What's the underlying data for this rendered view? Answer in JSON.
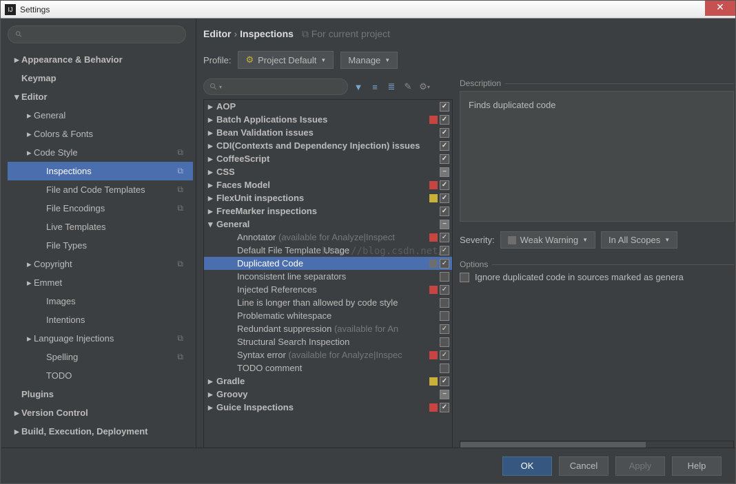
{
  "window": {
    "title": "Settings"
  },
  "breadcrumb": {
    "a": "Editor",
    "b": "Inspections",
    "suffix": "For current project"
  },
  "profile": {
    "label": "Profile:",
    "value": "Project Default",
    "manage": "Manage"
  },
  "sidebar": {
    "items": [
      {
        "label": "Appearance & Behavior",
        "arrow": "▸",
        "bold": true,
        "depth": 0
      },
      {
        "label": "Keymap",
        "bold": true,
        "depth": 0
      },
      {
        "label": "Editor",
        "arrow": "▾",
        "bold": true,
        "depth": 0
      },
      {
        "label": "General",
        "arrow": "▸",
        "depth": 1
      },
      {
        "label": "Colors & Fonts",
        "arrow": "▸",
        "depth": 1
      },
      {
        "label": "Code Style",
        "arrow": "▸",
        "depth": 1,
        "badge": "⧉"
      },
      {
        "label": "Inspections",
        "depth": 2,
        "selected": true,
        "badge": "⧉"
      },
      {
        "label": "File and Code Templates",
        "depth": 2,
        "badge": "⧉"
      },
      {
        "label": "File Encodings",
        "depth": 2,
        "badge": "⧉"
      },
      {
        "label": "Live Templates",
        "depth": 2
      },
      {
        "label": "File Types",
        "depth": 2
      },
      {
        "label": "Copyright",
        "arrow": "▸",
        "depth": 1,
        "badge": "⧉"
      },
      {
        "label": "Emmet",
        "arrow": "▸",
        "depth": 1
      },
      {
        "label": "Images",
        "depth": 2
      },
      {
        "label": "Intentions",
        "depth": 2
      },
      {
        "label": "Language Injections",
        "arrow": "▸",
        "depth": 1,
        "badge": "⧉"
      },
      {
        "label": "Spelling",
        "depth": 2,
        "badge": "⧉"
      },
      {
        "label": "TODO",
        "depth": 2
      },
      {
        "label": "Plugins",
        "bold": true,
        "depth": 0
      },
      {
        "label": "Version Control",
        "arrow": "▸",
        "bold": true,
        "depth": 0
      },
      {
        "label": "Build, Execution, Deployment",
        "arrow": "▸",
        "bold": true,
        "depth": 0
      }
    ]
  },
  "inspections": [
    {
      "label": "AOP",
      "arrow": "▸",
      "bold": true,
      "chk": "on"
    },
    {
      "label": "Batch Applications Issues",
      "arrow": "▸",
      "bold": true,
      "sev": "red",
      "chk": "on"
    },
    {
      "label": "Bean Validation issues",
      "arrow": "▸",
      "bold": true,
      "chk": "on"
    },
    {
      "label": "CDI(Contexts and Dependency Injection) issues",
      "arrow": "▸",
      "bold": true,
      "chk": "on"
    },
    {
      "label": "CoffeeScript",
      "arrow": "▸",
      "bold": true,
      "chk": "on"
    },
    {
      "label": "CSS",
      "arrow": "▸",
      "bold": true,
      "chk": "mixed"
    },
    {
      "label": "Faces Model",
      "arrow": "▸",
      "bold": true,
      "sev": "red",
      "chk": "on"
    },
    {
      "label": "FlexUnit inspections",
      "arrow": "▸",
      "bold": true,
      "sev": "yellow",
      "chk": "on"
    },
    {
      "label": "FreeMarker inspections",
      "arrow": "▸",
      "bold": true,
      "chk": "on"
    },
    {
      "label": "General",
      "arrow": "▾",
      "bold": true,
      "chk": "mixed"
    },
    {
      "label": "Annotator",
      "muted": " (available for Analyze|Inspect",
      "child": true,
      "sev": "red",
      "chk": "on"
    },
    {
      "label": "Default File Template Usage",
      "child": true,
      "chk": "on"
    },
    {
      "label": "Duplicated Code",
      "child": true,
      "selected": true,
      "sev": "gray",
      "chk": "on"
    },
    {
      "label": "Inconsistent line separators",
      "child": true,
      "chk": ""
    },
    {
      "label": "Injected References",
      "child": true,
      "sev": "red",
      "chk": "on"
    },
    {
      "label": "Line is longer than allowed by code style",
      "child": true,
      "chk": ""
    },
    {
      "label": "Problematic whitespace",
      "child": true,
      "chk": ""
    },
    {
      "label": "Redundant suppression",
      "muted": " (available for An",
      "child": true,
      "chk": "on"
    },
    {
      "label": "Structural Search Inspection",
      "child": true,
      "chk": ""
    },
    {
      "label": "Syntax error",
      "muted": " (available for Analyze|Inspec",
      "child": true,
      "sev": "red",
      "chk": "on"
    },
    {
      "label": "TODO comment",
      "child": true,
      "chk": ""
    },
    {
      "label": "Gradle",
      "arrow": "▸",
      "bold": true,
      "sev": "yellow",
      "chk": "on"
    },
    {
      "label": "Groovy",
      "arrow": "▸",
      "bold": true,
      "chk": "mixed"
    },
    {
      "label": "Guice Inspections",
      "arrow": "▸",
      "bold": true,
      "sev": "red",
      "chk": "on"
    }
  ],
  "detail": {
    "desc_heading": "Description",
    "desc_text": "Finds duplicated code",
    "sev_label": "Severity:",
    "sev_value": "Weak Warning",
    "scope_value": "In All Scopes",
    "opts_heading": "Options",
    "opt1": "Ignore duplicated code in sources marked as genera"
  },
  "footer": {
    "ok": "OK",
    "cancel": "Cancel",
    "apply": "Apply",
    "help": "Help"
  },
  "watermark": "http://blog.csdn.net/"
}
